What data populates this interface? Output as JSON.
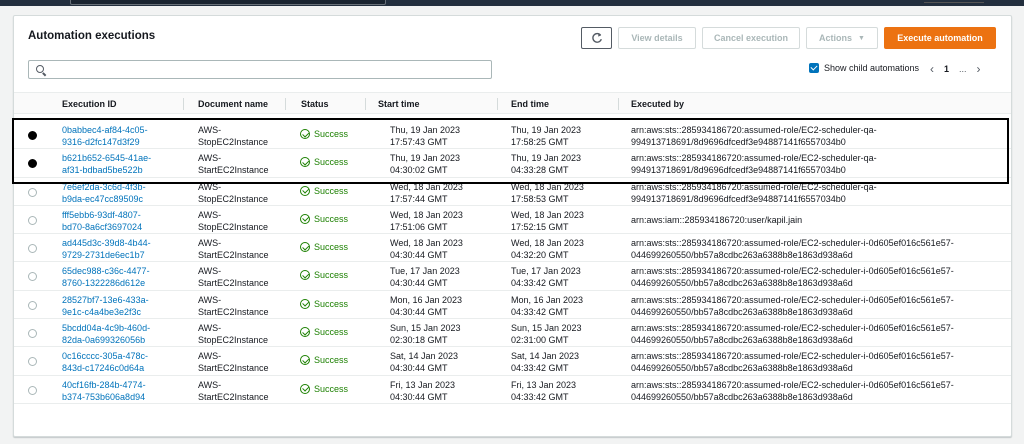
{
  "panel": {
    "title": "Automation executions",
    "buttons": {
      "refresh_icon": "refresh-icon",
      "view_details": "View details",
      "cancel_execution": "Cancel execution",
      "actions": "Actions",
      "execute_automation": "Execute automation"
    },
    "search": {
      "placeholder": ""
    },
    "show_child": {
      "label": "Show child automations",
      "checked": true
    },
    "pagination": {
      "page": "1",
      "ellipsis": "..."
    },
    "colors": {
      "accent": "#ec7211",
      "link": "#0073bb",
      "success": "#1d8102"
    }
  },
  "table": {
    "columns": [
      "Execution ID",
      "Document name",
      "Status",
      "Start time",
      "End time",
      "Executed by"
    ],
    "rows": [
      {
        "selected": true,
        "id": [
          "0babbec4-af84-4c05-",
          "9316-d2fc147d3f29"
        ],
        "doc": [
          "AWS-",
          "StopEC2Instance"
        ],
        "status": "Success",
        "start": [
          "Thu, 19 Jan 2023",
          "17:57:43 GMT"
        ],
        "end": [
          "Thu, 19 Jan 2023",
          "17:58:25 GMT"
        ],
        "by": [
          "arn:aws:sts::285934186720:assumed-role/EC2-scheduler-qa-",
          "994913718691/8d9696dfcedf3e94887141f6557034b0"
        ]
      },
      {
        "selected": true,
        "id": [
          "b621b652-6545-41ae-",
          "af31-bdbad5be522b"
        ],
        "doc": [
          "AWS-",
          "StartEC2Instance"
        ],
        "status": "Success",
        "start": [
          "Thu, 19 Jan 2023",
          "04:30:02 GMT"
        ],
        "end": [
          "Thu, 19 Jan 2023",
          "04:33:28 GMT"
        ],
        "by": [
          "arn:aws:sts::285934186720:assumed-role/EC2-scheduler-qa-",
          "994913718691/8d9696dfcedf3e94887141f6557034b0"
        ]
      },
      {
        "selected": false,
        "id": [
          "7e6ef2da-3c6d-4f3b-",
          "b9da-ec47cc89509c"
        ],
        "doc": [
          "AWS-",
          "StopEC2Instance"
        ],
        "status": "Success",
        "start": [
          "Wed, 18 Jan 2023",
          "17:57:44 GMT"
        ],
        "end": [
          "Wed, 18 Jan 2023",
          "17:58:53 GMT"
        ],
        "by": [
          "arn:aws:sts::285934186720:assumed-role/EC2-scheduler-qa-",
          "994913718691/8d9696dfcedf3e94887141f6557034b0"
        ]
      },
      {
        "selected": false,
        "id": [
          "fff5ebb6-93df-4807-",
          "bd70-8a6cf3697024"
        ],
        "doc": [
          "AWS-",
          "StopEC2Instance"
        ],
        "status": "Success",
        "start": [
          "Wed, 18 Jan 2023",
          "17:51:06 GMT"
        ],
        "end": [
          "Wed, 18 Jan 2023",
          "17:52:15 GMT"
        ],
        "by": [
          "arn:aws:iam::285934186720:user/kapil.jain",
          ""
        ]
      },
      {
        "selected": false,
        "id": [
          "ad445d3c-39d8-4b44-",
          "9729-2731de6ec1b7"
        ],
        "doc": [
          "AWS-",
          "StartEC2Instance"
        ],
        "status": "Success",
        "start": [
          "Wed, 18 Jan 2023",
          "04:30:44 GMT"
        ],
        "end": [
          "Wed, 18 Jan 2023",
          "04:32:20 GMT"
        ],
        "by": [
          "arn:aws:sts::285934186720:assumed-role/EC2-scheduler-i-0d605ef016c561e57-",
          "044699260550/bb57a8cdbc263a6388b8e1863d938a6d"
        ]
      },
      {
        "selected": false,
        "id": [
          "65dec988-c36c-4477-",
          "8760-1322286d612e"
        ],
        "doc": [
          "AWS-",
          "StartEC2Instance"
        ],
        "status": "Success",
        "start": [
          "Tue, 17 Jan 2023",
          "04:30:44 GMT"
        ],
        "end": [
          "Tue, 17 Jan 2023",
          "04:33:42 GMT"
        ],
        "by": [
          "arn:aws:sts::285934186720:assumed-role/EC2-scheduler-i-0d605ef016c561e57-",
          "044699260550/bb57a8cdbc263a6388b8e1863d938a6d"
        ]
      },
      {
        "selected": false,
        "id": [
          "28527bf7-13e6-433a-",
          "9e1c-c4a4be3e2f3c"
        ],
        "doc": [
          "AWS-",
          "StartEC2Instance"
        ],
        "status": "Success",
        "start": [
          "Mon, 16 Jan 2023",
          "04:30:44 GMT"
        ],
        "end": [
          "Mon, 16 Jan 2023",
          "04:33:42 GMT"
        ],
        "by": [
          "arn:aws:sts::285934186720:assumed-role/EC2-scheduler-i-0d605ef016c561e57-",
          "044699260550/bb57a8cdbc263a6388b8e1863d938a6d"
        ]
      },
      {
        "selected": false,
        "id": [
          "5bcdd04a-4c9b-460d-",
          "82da-0a699326056b"
        ],
        "doc": [
          "AWS-",
          "StopEC2Instance"
        ],
        "status": "Success",
        "start": [
          "Sun, 15 Jan 2023",
          "02:30:18 GMT"
        ],
        "end": [
          "Sun, 15 Jan 2023",
          "02:31:00 GMT"
        ],
        "by": [
          "arn:aws:sts::285934186720:assumed-role/EC2-scheduler-i-0d605ef016c561e57-",
          "044699260550/bb57a8cdbc263a6388b8e1863d938a6d"
        ]
      },
      {
        "selected": false,
        "id": [
          "0c16cccc-305a-478c-",
          "843d-c17246c0d64a"
        ],
        "doc": [
          "AWS-",
          "StartEC2Instance"
        ],
        "status": "Success",
        "start": [
          "Sat, 14 Jan 2023",
          "04:30:44 GMT"
        ],
        "end": [
          "Sat, 14 Jan 2023",
          "04:33:42 GMT"
        ],
        "by": [
          "arn:aws:sts::285934186720:assumed-role/EC2-scheduler-i-0d605ef016c561e57-",
          "044699260550/bb57a8cdbc263a6388b8e1863d938a6d"
        ]
      },
      {
        "selected": false,
        "id": [
          "40cf16fb-284b-4774-",
          "b374-753b606a8d94"
        ],
        "doc": [
          "AWS-",
          "StartEC2Instance"
        ],
        "status": "Success",
        "start": [
          "Fri, 13 Jan 2023",
          "04:30:44 GMT"
        ],
        "end": [
          "Fri, 13 Jan 2023",
          "04:33:42 GMT"
        ],
        "by": [
          "arn:aws:sts::285934186720:assumed-role/EC2-scheduler-i-0d605ef016c561e57-",
          "044699260550/bb57a8cdbc263a6388b8e1863d938a6d"
        ]
      }
    ]
  }
}
